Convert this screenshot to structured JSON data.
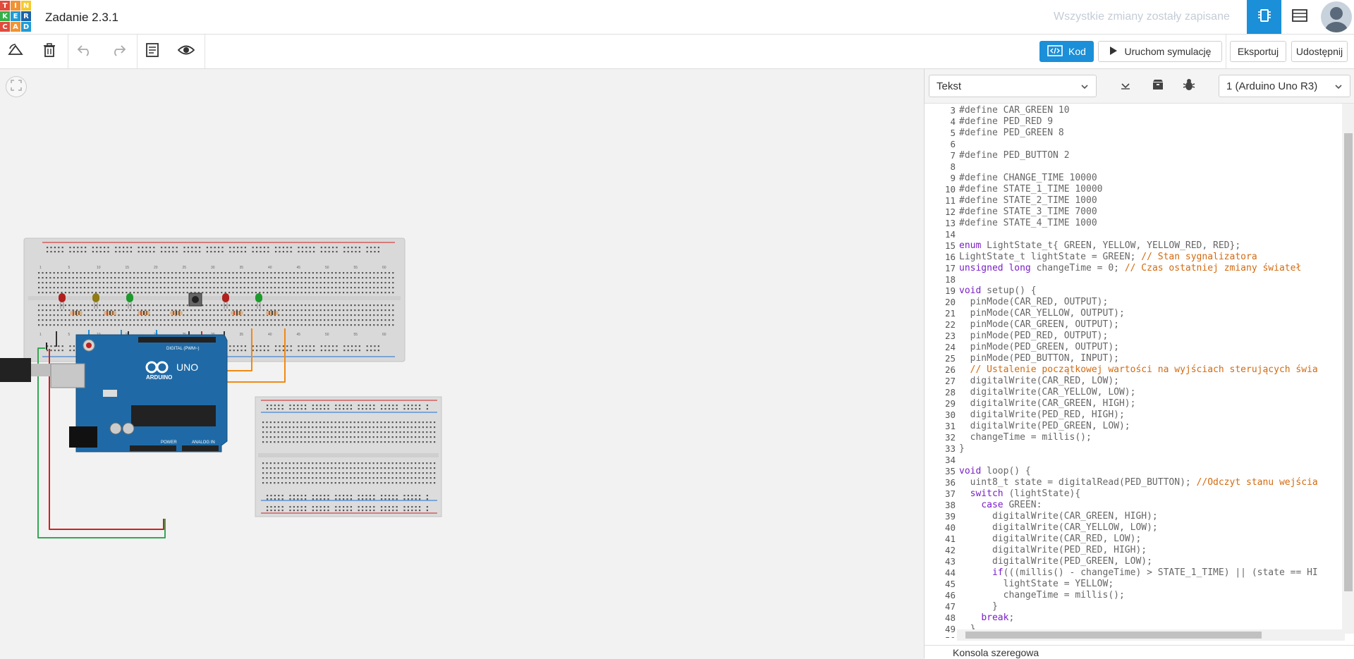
{
  "logo": {
    "letters": [
      "T",
      "I",
      "N",
      "K",
      "E",
      "R",
      "C",
      "A",
      "D"
    ],
    "colors": [
      "#e04b3b",
      "#f19332",
      "#f5c92e",
      "#35b048",
      "#1f9bd7",
      "#1b62a9",
      "#e04b3b",
      "#f19332",
      "#1f9bd7"
    ]
  },
  "header": {
    "title": "Zadanie 2.3.1",
    "saved_status": "Wszystkie zmiany zostały zapisane"
  },
  "toolbar": {
    "code_label": "Kod",
    "simulate_label": "Uruchom symulację",
    "export_label": "Eksportuj",
    "share_label": "Udostępnij"
  },
  "code_panel": {
    "mode": "Tekst",
    "board": "1 (Arduino Uno R3)",
    "serial_label": "Konsola szeregowa",
    "lines": [
      {
        "n": "3",
        "segs": [
          {
            "t": "#define CAR_GREEN 10"
          }
        ]
      },
      {
        "n": "4",
        "segs": [
          {
            "t": "#define PED_RED 9"
          }
        ]
      },
      {
        "n": "5",
        "segs": [
          {
            "t": "#define PED_GREEN 8"
          }
        ]
      },
      {
        "n": "6",
        "segs": []
      },
      {
        "n": "7",
        "segs": [
          {
            "t": "#define PED_BUTTON 2"
          }
        ]
      },
      {
        "n": "8",
        "segs": []
      },
      {
        "n": "9",
        "segs": [
          {
            "t": "#define CHANGE_TIME 10000"
          }
        ]
      },
      {
        "n": "10",
        "segs": [
          {
            "t": "#define STATE_1_TIME 10000"
          }
        ]
      },
      {
        "n": "11",
        "segs": [
          {
            "t": "#define STATE_2_TIME 1000"
          }
        ]
      },
      {
        "n": "12",
        "segs": [
          {
            "t": "#define STATE_3_TIME 7000"
          }
        ]
      },
      {
        "n": "13",
        "segs": [
          {
            "t": "#define STATE_4_TIME 1000"
          }
        ]
      },
      {
        "n": "14",
        "segs": []
      },
      {
        "n": "15",
        "segs": [
          {
            "t": "enum",
            "c": "kw"
          },
          {
            "t": " LightState_t{ GREEN, YELLOW, YELLOW_RED, RED};"
          }
        ]
      },
      {
        "n": "16",
        "segs": [
          {
            "t": "LightState_t lightState = GREEN; "
          },
          {
            "t": "// Stan sygnalizatora",
            "c": "cm"
          }
        ]
      },
      {
        "n": "17",
        "segs": [
          {
            "t": "unsigned long",
            "c": "kw"
          },
          {
            "t": " changeTime = 0; "
          },
          {
            "t": "// Czas ostatniej zmiany świateł",
            "c": "cm"
          }
        ]
      },
      {
        "n": "18",
        "segs": []
      },
      {
        "n": "19",
        "segs": [
          {
            "t": "void",
            "c": "kw"
          },
          {
            "t": " setup() {"
          }
        ]
      },
      {
        "n": "20",
        "segs": [
          {
            "t": "  pinMode(CAR_RED, OUTPUT);"
          }
        ]
      },
      {
        "n": "21",
        "segs": [
          {
            "t": "  pinMode(CAR_YELLOW, OUTPUT);"
          }
        ]
      },
      {
        "n": "22",
        "segs": [
          {
            "t": "  pinMode(CAR_GREEN, OUTPUT);"
          }
        ]
      },
      {
        "n": "23",
        "segs": [
          {
            "t": "  pinMode(PED_RED, OUTPUT);"
          }
        ]
      },
      {
        "n": "24",
        "segs": [
          {
            "t": "  pinMode(PED_GREEN, OUTPUT);"
          }
        ]
      },
      {
        "n": "25",
        "segs": [
          {
            "t": "  pinMode(PED_BUTTON, INPUT);"
          }
        ]
      },
      {
        "n": "26",
        "segs": [
          {
            "t": "  "
          },
          {
            "t": "// Ustalenie początkowej wartości na wyjściach sterujących świa",
            "c": "cm"
          }
        ]
      },
      {
        "n": "27",
        "segs": [
          {
            "t": "  digitalWrite(CAR_RED, LOW);"
          }
        ]
      },
      {
        "n": "28",
        "segs": [
          {
            "t": "  digitalWrite(CAR_YELLOW, LOW);"
          }
        ]
      },
      {
        "n": "29",
        "segs": [
          {
            "t": "  digitalWrite(CAR_GREEN, HIGH);"
          }
        ]
      },
      {
        "n": "30",
        "segs": [
          {
            "t": "  digitalWrite(PED_RED, HIGH);"
          }
        ]
      },
      {
        "n": "31",
        "segs": [
          {
            "t": "  digitalWrite(PED_GREEN, LOW);"
          }
        ]
      },
      {
        "n": "32",
        "segs": [
          {
            "t": "  changeTime = millis();"
          }
        ]
      },
      {
        "n": "33",
        "segs": [
          {
            "t": "}"
          }
        ]
      },
      {
        "n": "34",
        "segs": []
      },
      {
        "n": "35",
        "segs": [
          {
            "t": "void",
            "c": "kw"
          },
          {
            "t": " loop() {"
          }
        ]
      },
      {
        "n": "36",
        "segs": [
          {
            "t": "  uint8_t state = digitalRead(PED_BUTTON); "
          },
          {
            "t": "//Odczyt stanu wejścia",
            "c": "cm"
          }
        ]
      },
      {
        "n": "37",
        "segs": [
          {
            "t": "  "
          },
          {
            "t": "switch",
            "c": "kw"
          },
          {
            "t": " (lightState){"
          }
        ]
      },
      {
        "n": "38",
        "segs": [
          {
            "t": "    "
          },
          {
            "t": "case",
            "c": "kw"
          },
          {
            "t": " GREEN:"
          }
        ]
      },
      {
        "n": "39",
        "segs": [
          {
            "t": "      digitalWrite(CAR_GREEN, HIGH);"
          }
        ]
      },
      {
        "n": "40",
        "segs": [
          {
            "t": "      digitalWrite(CAR_YELLOW, LOW);"
          }
        ]
      },
      {
        "n": "41",
        "segs": [
          {
            "t": "      digitalWrite(CAR_RED, LOW);"
          }
        ]
      },
      {
        "n": "42",
        "segs": [
          {
            "t": "      digitalWrite(PED_RED, HIGH);"
          }
        ]
      },
      {
        "n": "43",
        "segs": [
          {
            "t": "      digitalWrite(PED_GREEN, LOW);"
          }
        ]
      },
      {
        "n": "44",
        "segs": [
          {
            "t": "      "
          },
          {
            "t": "if",
            "c": "kw"
          },
          {
            "t": "(((millis() - changeTime) > STATE_1_TIME) || (state == HI"
          }
        ]
      },
      {
        "n": "45",
        "segs": [
          {
            "t": "        lightState = YELLOW;"
          }
        ]
      },
      {
        "n": "46",
        "segs": [
          {
            "t": "        changeTime = millis();"
          }
        ]
      },
      {
        "n": "47",
        "segs": [
          {
            "t": "      }"
          }
        ]
      },
      {
        "n": "48",
        "segs": [
          {
            "t": "    "
          },
          {
            "t": "break",
            "c": "kw"
          },
          {
            "t": ";"
          }
        ]
      },
      {
        "n": "49",
        "segs": [
          {
            "t": "  }"
          }
        ]
      },
      {
        "n": "50",
        "segs": [
          {
            "t": "}"
          }
        ]
      }
    ]
  },
  "circuit": {
    "arduino_brand": "ARDUINO",
    "arduino_model": "UNO",
    "digital_label": "DIGITAL (PWM~)",
    "power_label": "POWER",
    "analog_label": "ANALOG IN",
    "breadboard_col_labels": [
      "1",
      "5",
      "10",
      "15",
      "20",
      "25",
      "30",
      "35",
      "40",
      "45",
      "50",
      "55",
      "60"
    ],
    "led_colors": [
      "red",
      "yellow",
      "green",
      "red",
      "green"
    ]
  },
  "colors": {
    "accent": "#1b8fd8",
    "keyword": "#7a1ec7",
    "comment": "#d26a10",
    "arduino_board": "#1f6aa6",
    "wire_blue": "#1e90d8",
    "wire_orange": "#f08a14",
    "wire_yellow": "#e8c400",
    "wire_green": "#34a853",
    "wire_red": "#d12020",
    "wire_black": "#222222"
  }
}
